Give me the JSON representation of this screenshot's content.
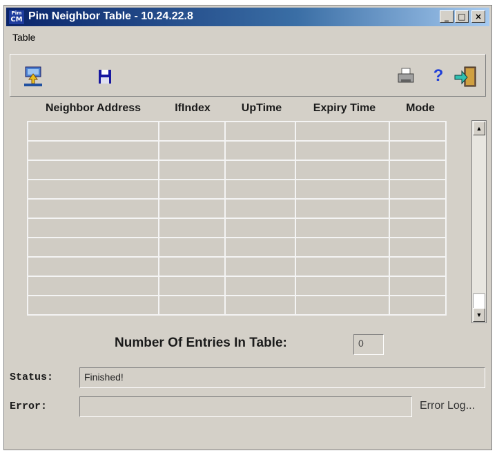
{
  "window": {
    "title": "Pim Neighbor Table - 10.24.22.8",
    "icon_text_top": "Pim",
    "icon_text_bottom": "CM",
    "min_glyph": "_",
    "max_glyph": "□",
    "close_glyph": "×"
  },
  "menu": {
    "table_label": "Table"
  },
  "toolbar": {
    "icons": [
      "upload-icon",
      "save-icon",
      "print-icon",
      "help-icon",
      "exit-icon"
    ],
    "help_glyph": "?"
  },
  "table": {
    "columns": [
      "Neighbor Address",
      "IfIndex",
      "UpTime",
      "Expiry Time",
      "Mode"
    ],
    "rows": []
  },
  "scrollbar": {
    "up_glyph": "▲",
    "down_glyph": "▼"
  },
  "entries": {
    "label": "Number Of Entries In Table:",
    "value": "0"
  },
  "status": {
    "label": "Status:",
    "value": "Finished!"
  },
  "error": {
    "label": "Error:",
    "value": "",
    "log_link": "Error Log..."
  },
  "colors": {
    "title_gradient_start": "#0a246a",
    "title_gradient_end": "#a6caf0",
    "window_bg": "#d4d0c8",
    "help_blue": "#1f3fd8"
  }
}
